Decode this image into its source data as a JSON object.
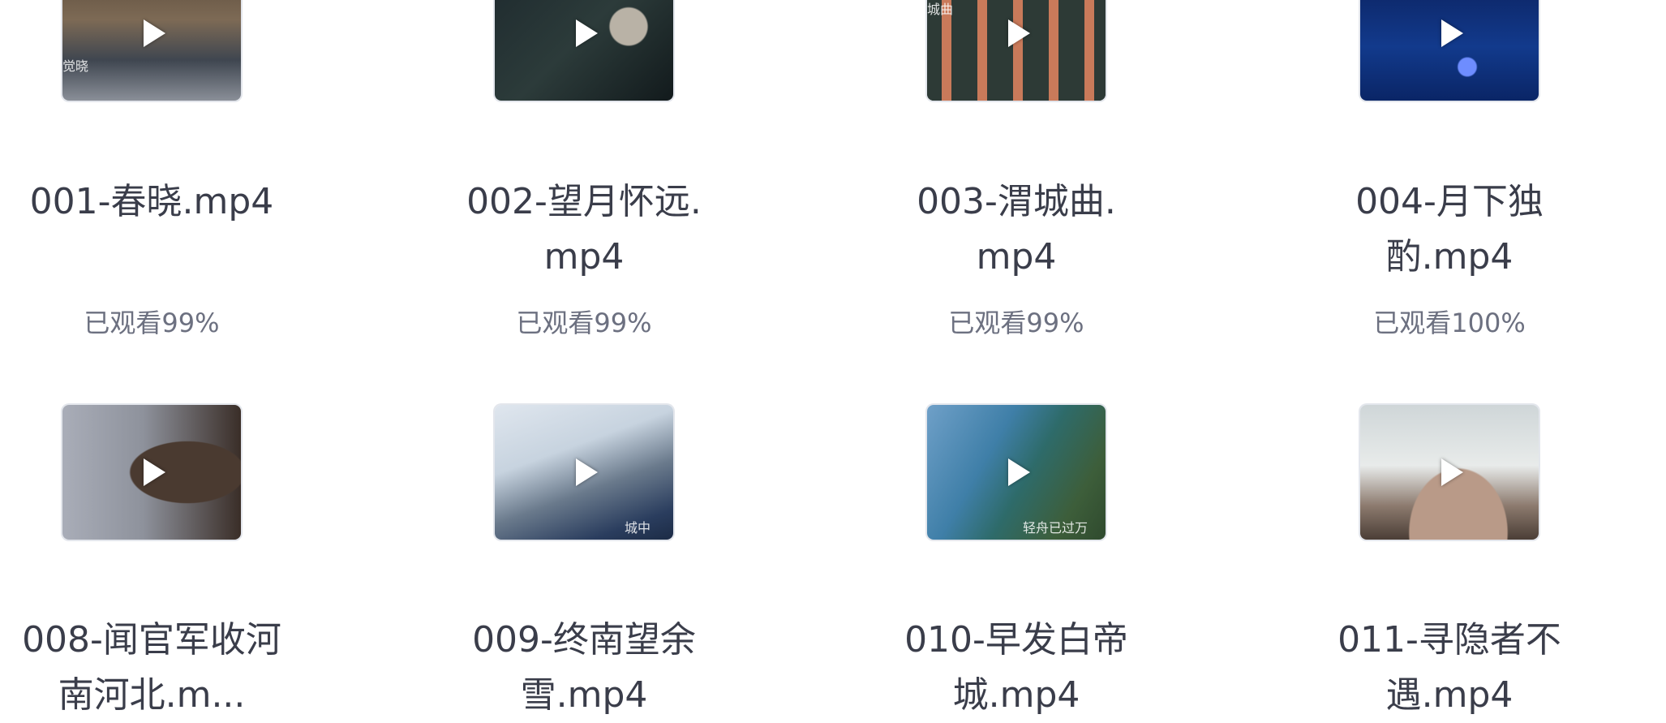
{
  "videos": [
    {
      "title": "001-春晓.mp4",
      "progress_text": "已观看99%",
      "watched_fraction": 0.99,
      "overlay": "觉晓"
    },
    {
      "title": "002-望月怀远.mp4",
      "progress_text": "已观看99%",
      "watched_fraction": 0.99,
      "overlay": ""
    },
    {
      "title": "003-渭城曲.mp4",
      "progress_text": "已观看99%",
      "watched_fraction": 0.99,
      "overlay": "城曲"
    },
    {
      "title": "004-月下独酌.mp4",
      "progress_text": "已观看100%",
      "watched_fraction": 1.0,
      "overlay": ""
    },
    {
      "title": "008-闻官军收河南河北.m...",
      "progress_text": "",
      "watched_fraction": null,
      "overlay": ""
    },
    {
      "title": "009-终南望余雪.mp4",
      "progress_text": "",
      "watched_fraction": null,
      "overlay": "城中"
    },
    {
      "title": "010-早发白帝城.mp4",
      "progress_text": "",
      "watched_fraction": null,
      "overlay": "轻舟已过万"
    },
    {
      "title": "011-寻隐者不遇.mp4",
      "progress_text": "",
      "watched_fraction": null,
      "overlay": ""
    }
  ],
  "colors": {
    "title": "#3a3d4a",
    "progress": "#6c7080",
    "thumb_border": "#e3e6ec"
  },
  "icons": {
    "play": "play-icon"
  }
}
